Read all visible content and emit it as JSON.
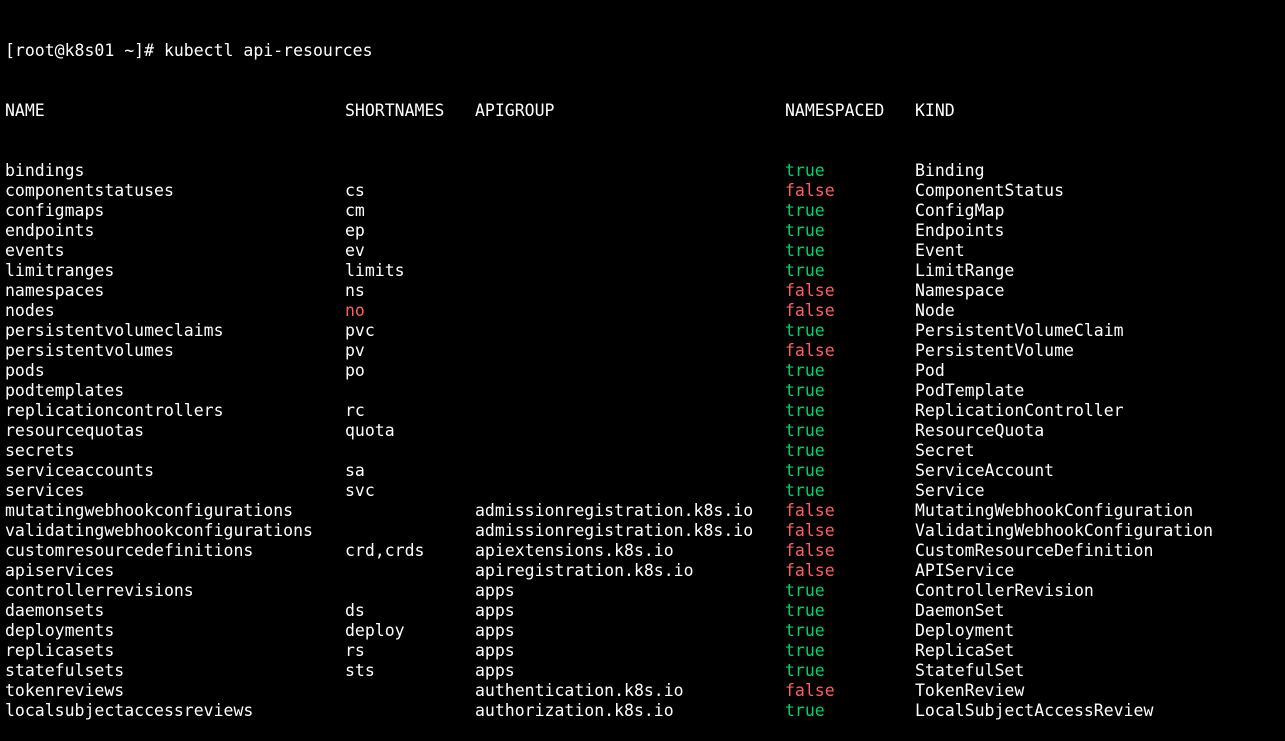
{
  "prompt": {
    "text": "[root@k8s01 ~]# kubectl api-resources"
  },
  "headers": {
    "name": "NAME",
    "shortnames": "SHORTNAMES",
    "apigroup": "APIGROUP",
    "namespaced": "NAMESPACED",
    "kind": "KIND"
  },
  "colors": {
    "background": "#000000",
    "foreground": "#ffffff",
    "true": "#00d26a",
    "false": "#ff5f5f"
  },
  "rows": [
    {
      "name": "bindings",
      "short": "",
      "group": "",
      "ns": "true",
      "kind": "Binding"
    },
    {
      "name": "componentstatuses",
      "short": "cs",
      "group": "",
      "ns": "false",
      "kind": "ComponentStatus"
    },
    {
      "name": "configmaps",
      "short": "cm",
      "group": "",
      "ns": "true",
      "kind": "ConfigMap"
    },
    {
      "name": "endpoints",
      "short": "ep",
      "group": "",
      "ns": "true",
      "kind": "Endpoints"
    },
    {
      "name": "events",
      "short": "ev",
      "group": "",
      "ns": "true",
      "kind": "Event"
    },
    {
      "name": "limitranges",
      "short": "limits",
      "group": "",
      "ns": "true",
      "kind": "LimitRange"
    },
    {
      "name": "namespaces",
      "short": "ns",
      "group": "",
      "ns": "false",
      "kind": "Namespace"
    },
    {
      "name": "nodes",
      "short": "no",
      "short_red": true,
      "group": "",
      "ns": "false",
      "kind": "Node"
    },
    {
      "name": "persistentvolumeclaims",
      "short": "pvc",
      "group": "",
      "ns": "true",
      "kind": "PersistentVolumeClaim"
    },
    {
      "name": "persistentvolumes",
      "short": "pv",
      "group": "",
      "ns": "false",
      "kind": "PersistentVolume"
    },
    {
      "name": "pods",
      "short": "po",
      "group": "",
      "ns": "true",
      "kind": "Pod"
    },
    {
      "name": "podtemplates",
      "short": "",
      "group": "",
      "ns": "true",
      "kind": "PodTemplate"
    },
    {
      "name": "replicationcontrollers",
      "short": "rc",
      "group": "",
      "ns": "true",
      "kind": "ReplicationController"
    },
    {
      "name": "resourcequotas",
      "short": "quota",
      "group": "",
      "ns": "true",
      "kind": "ResourceQuota"
    },
    {
      "name": "secrets",
      "short": "",
      "group": "",
      "ns": "true",
      "kind": "Secret"
    },
    {
      "name": "serviceaccounts",
      "short": "sa",
      "group": "",
      "ns": "true",
      "kind": "ServiceAccount"
    },
    {
      "name": "services",
      "short": "svc",
      "group": "",
      "ns": "true",
      "kind": "Service"
    },
    {
      "name": "mutatingwebhookconfigurations",
      "short": "",
      "group": "admissionregistration.k8s.io",
      "ns": "false",
      "kind": "MutatingWebhookConfiguration"
    },
    {
      "name": "validatingwebhookconfigurations",
      "short": "",
      "group": "admissionregistration.k8s.io",
      "ns": "false",
      "kind": "ValidatingWebhookConfiguration"
    },
    {
      "name": "customresourcedefinitions",
      "short": "crd,crds",
      "group": "apiextensions.k8s.io",
      "ns": "false",
      "kind": "CustomResourceDefinition"
    },
    {
      "name": "apiservices",
      "short": "",
      "group": "apiregistration.k8s.io",
      "ns": "false",
      "kind": "APIService"
    },
    {
      "name": "controllerrevisions",
      "short": "",
      "group": "apps",
      "ns": "true",
      "kind": "ControllerRevision"
    },
    {
      "name": "daemonsets",
      "short": "ds",
      "group": "apps",
      "ns": "true",
      "kind": "DaemonSet"
    },
    {
      "name": "deployments",
      "short": "deploy",
      "group": "apps",
      "ns": "true",
      "kind": "Deployment"
    },
    {
      "name": "replicasets",
      "short": "rs",
      "group": "apps",
      "ns": "true",
      "kind": "ReplicaSet"
    },
    {
      "name": "statefulsets",
      "short": "sts",
      "group": "apps",
      "ns": "true",
      "kind": "StatefulSet"
    },
    {
      "name": "tokenreviews",
      "short": "",
      "group": "authentication.k8s.io",
      "ns": "false",
      "kind": "TokenReview"
    },
    {
      "name": "localsubjectaccessreviews",
      "short": "",
      "group": "authorization.k8s.io",
      "ns": "true",
      "kind": "LocalSubjectAccessReview"
    }
  ]
}
